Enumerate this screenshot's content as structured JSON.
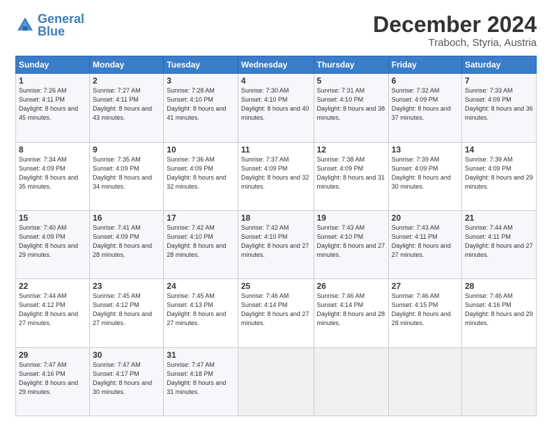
{
  "logo": {
    "text_general": "General",
    "text_blue": "Blue"
  },
  "header": {
    "title": "December 2024",
    "subtitle": "Traboch, Styria, Austria"
  },
  "days_of_week": [
    "Sunday",
    "Monday",
    "Tuesday",
    "Wednesday",
    "Thursday",
    "Friday",
    "Saturday"
  ],
  "weeks": [
    [
      {
        "day": 1,
        "sunrise": "7:26 AM",
        "sunset": "4:11 PM",
        "daylight": "8 hours and 45 minutes."
      },
      {
        "day": 2,
        "sunrise": "7:27 AM",
        "sunset": "4:11 PM",
        "daylight": "8 hours and 43 minutes."
      },
      {
        "day": 3,
        "sunrise": "7:28 AM",
        "sunset": "4:10 PM",
        "daylight": "8 hours and 41 minutes."
      },
      {
        "day": 4,
        "sunrise": "7:30 AM",
        "sunset": "4:10 PM",
        "daylight": "8 hours and 40 minutes."
      },
      {
        "day": 5,
        "sunrise": "7:31 AM",
        "sunset": "4:10 PM",
        "daylight": "8 hours and 38 minutes."
      },
      {
        "day": 6,
        "sunrise": "7:32 AM",
        "sunset": "4:09 PM",
        "daylight": "8 hours and 37 minutes."
      },
      {
        "day": 7,
        "sunrise": "7:33 AM",
        "sunset": "4:09 PM",
        "daylight": "8 hours and 36 minutes."
      }
    ],
    [
      {
        "day": 8,
        "sunrise": "7:34 AM",
        "sunset": "4:09 PM",
        "daylight": "8 hours and 35 minutes."
      },
      {
        "day": 9,
        "sunrise": "7:35 AM",
        "sunset": "4:09 PM",
        "daylight": "8 hours and 34 minutes."
      },
      {
        "day": 10,
        "sunrise": "7:36 AM",
        "sunset": "4:09 PM",
        "daylight": "8 hours and 32 minutes."
      },
      {
        "day": 11,
        "sunrise": "7:37 AM",
        "sunset": "4:09 PM",
        "daylight": "8 hours and 32 minutes."
      },
      {
        "day": 12,
        "sunrise": "7:38 AM",
        "sunset": "4:09 PM",
        "daylight": "8 hours and 31 minutes."
      },
      {
        "day": 13,
        "sunrise": "7:39 AM",
        "sunset": "4:09 PM",
        "daylight": "8 hours and 30 minutes."
      },
      {
        "day": 14,
        "sunrise": "7:39 AM",
        "sunset": "4:09 PM",
        "daylight": "8 hours and 29 minutes."
      }
    ],
    [
      {
        "day": 15,
        "sunrise": "7:40 AM",
        "sunset": "4:09 PM",
        "daylight": "8 hours and 29 minutes."
      },
      {
        "day": 16,
        "sunrise": "7:41 AM",
        "sunset": "4:09 PM",
        "daylight": "8 hours and 28 minutes."
      },
      {
        "day": 17,
        "sunrise": "7:42 AM",
        "sunset": "4:10 PM",
        "daylight": "8 hours and 28 minutes."
      },
      {
        "day": 18,
        "sunrise": "7:42 AM",
        "sunset": "4:10 PM",
        "daylight": "8 hours and 27 minutes."
      },
      {
        "day": 19,
        "sunrise": "7:43 AM",
        "sunset": "4:10 PM",
        "daylight": "8 hours and 27 minutes."
      },
      {
        "day": 20,
        "sunrise": "7:43 AM",
        "sunset": "4:11 PM",
        "daylight": "8 hours and 27 minutes."
      },
      {
        "day": 21,
        "sunrise": "7:44 AM",
        "sunset": "4:11 PM",
        "daylight": "8 hours and 27 minutes."
      }
    ],
    [
      {
        "day": 22,
        "sunrise": "7:44 AM",
        "sunset": "4:12 PM",
        "daylight": "8 hours and 27 minutes."
      },
      {
        "day": 23,
        "sunrise": "7:45 AM",
        "sunset": "4:12 PM",
        "daylight": "8 hours and 27 minutes."
      },
      {
        "day": 24,
        "sunrise": "7:45 AM",
        "sunset": "4:13 PM",
        "daylight": "8 hours and 27 minutes."
      },
      {
        "day": 25,
        "sunrise": "7:46 AM",
        "sunset": "4:14 PM",
        "daylight": "8 hours and 27 minutes."
      },
      {
        "day": 26,
        "sunrise": "7:46 AM",
        "sunset": "4:14 PM",
        "daylight": "8 hours and 28 minutes."
      },
      {
        "day": 27,
        "sunrise": "7:46 AM",
        "sunset": "4:15 PM",
        "daylight": "8 hours and 28 minutes."
      },
      {
        "day": 28,
        "sunrise": "7:46 AM",
        "sunset": "4:16 PM",
        "daylight": "8 hours and 29 minutes."
      }
    ],
    [
      {
        "day": 29,
        "sunrise": "7:47 AM",
        "sunset": "4:16 PM",
        "daylight": "8 hours and 29 minutes."
      },
      {
        "day": 30,
        "sunrise": "7:47 AM",
        "sunset": "4:17 PM",
        "daylight": "8 hours and 30 minutes."
      },
      {
        "day": 31,
        "sunrise": "7:47 AM",
        "sunset": "4:18 PM",
        "daylight": "8 hours and 31 minutes."
      },
      null,
      null,
      null,
      null
    ]
  ]
}
